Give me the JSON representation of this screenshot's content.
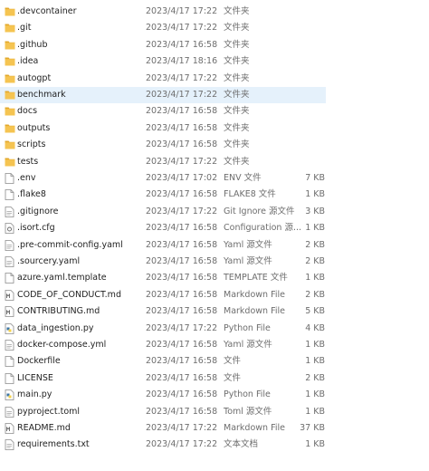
{
  "files": [
    {
      "name": ".devcontainer",
      "date": "2023/4/17 17:22",
      "type": "文件夹",
      "size": "",
      "icon": "folder-icon"
    },
    {
      "name": ".git",
      "date": "2023/4/17 17:22",
      "type": "文件夹",
      "size": "",
      "icon": "folder-icon"
    },
    {
      "name": ".github",
      "date": "2023/4/17 16:58",
      "type": "文件夹",
      "size": "",
      "icon": "folder-icon"
    },
    {
      "name": ".idea",
      "date": "2023/4/17 18:16",
      "type": "文件夹",
      "size": "",
      "icon": "folder-icon"
    },
    {
      "name": "autogpt",
      "date": "2023/4/17 17:22",
      "type": "文件夹",
      "size": "",
      "icon": "folder-icon"
    },
    {
      "name": "benchmark",
      "date": "2023/4/17 17:22",
      "type": "文件夹",
      "size": "",
      "icon": "folder-icon",
      "selected": true
    },
    {
      "name": "docs",
      "date": "2023/4/17 16:58",
      "type": "文件夹",
      "size": "",
      "icon": "folder-icon"
    },
    {
      "name": "outputs",
      "date": "2023/4/17 16:58",
      "type": "文件夹",
      "size": "",
      "icon": "folder-icon"
    },
    {
      "name": "scripts",
      "date": "2023/4/17 16:58",
      "type": "文件夹",
      "size": "",
      "icon": "folder-icon"
    },
    {
      "name": "tests",
      "date": "2023/4/17 17:22",
      "type": "文件夹",
      "size": "",
      "icon": "folder-icon"
    },
    {
      "name": ".env",
      "date": "2023/4/17 17:02",
      "type": "ENV 文件",
      "size": "7 KB",
      "icon": "file-icon"
    },
    {
      "name": ".flake8",
      "date": "2023/4/17 16:58",
      "type": "FLAKE8 文件",
      "size": "1 KB",
      "icon": "file-icon"
    },
    {
      "name": ".gitignore",
      "date": "2023/4/17 17:22",
      "type": "Git Ignore 源文件",
      "size": "3 KB",
      "icon": "text-file-icon"
    },
    {
      "name": ".isort.cfg",
      "date": "2023/4/17 16:58",
      "type": "Configuration 源...",
      "size": "1 KB",
      "icon": "config-file-icon"
    },
    {
      "name": ".pre-commit-config.yaml",
      "date": "2023/4/17 16:58",
      "type": "Yaml 源文件",
      "size": "2 KB",
      "icon": "text-file-icon"
    },
    {
      "name": ".sourcery.yaml",
      "date": "2023/4/17 16:58",
      "type": "Yaml 源文件",
      "size": "2 KB",
      "icon": "text-file-icon"
    },
    {
      "name": "azure.yaml.template",
      "date": "2023/4/17 16:58",
      "type": "TEMPLATE 文件",
      "size": "1 KB",
      "icon": "file-icon"
    },
    {
      "name": "CODE_OF_CONDUCT.md",
      "date": "2023/4/17 16:58",
      "type": "Markdown File",
      "size": "2 KB",
      "icon": "markdown-file-icon"
    },
    {
      "name": "CONTRIBUTING.md",
      "date": "2023/4/17 16:58",
      "type": "Markdown File",
      "size": "5 KB",
      "icon": "markdown-file-icon"
    },
    {
      "name": "data_ingestion.py",
      "date": "2023/4/17 17:22",
      "type": "Python File",
      "size": "4 KB",
      "icon": "python-file-icon"
    },
    {
      "name": "docker-compose.yml",
      "date": "2023/4/17 16:58",
      "type": "Yaml 源文件",
      "size": "1 KB",
      "icon": "text-file-icon"
    },
    {
      "name": "Dockerfile",
      "date": "2023/4/17 16:58",
      "type": "文件",
      "size": "1 KB",
      "icon": "file-icon"
    },
    {
      "name": "LICENSE",
      "date": "2023/4/17 16:58",
      "type": "文件",
      "size": "2 KB",
      "icon": "file-icon"
    },
    {
      "name": "main.py",
      "date": "2023/4/17 16:58",
      "type": "Python File",
      "size": "1 KB",
      "icon": "python-file-icon"
    },
    {
      "name": "pyproject.toml",
      "date": "2023/4/17 16:58",
      "type": "Toml 源文件",
      "size": "1 KB",
      "icon": "text-file-icon"
    },
    {
      "name": "README.md",
      "date": "2023/4/17 17:22",
      "type": "Markdown File",
      "size": "37 KB",
      "icon": "markdown-file-icon"
    },
    {
      "name": "requirements.txt",
      "date": "2023/4/17 17:22",
      "type": "文本文档",
      "size": "1 KB",
      "icon": "text-file-icon"
    }
  ],
  "colors": {
    "folder": "#f5c451",
    "folder_dark": "#e3a92c",
    "selected_bg": "#e5f1fb",
    "python_blue": "#3772a4",
    "python_yellow": "#f6d24a"
  }
}
